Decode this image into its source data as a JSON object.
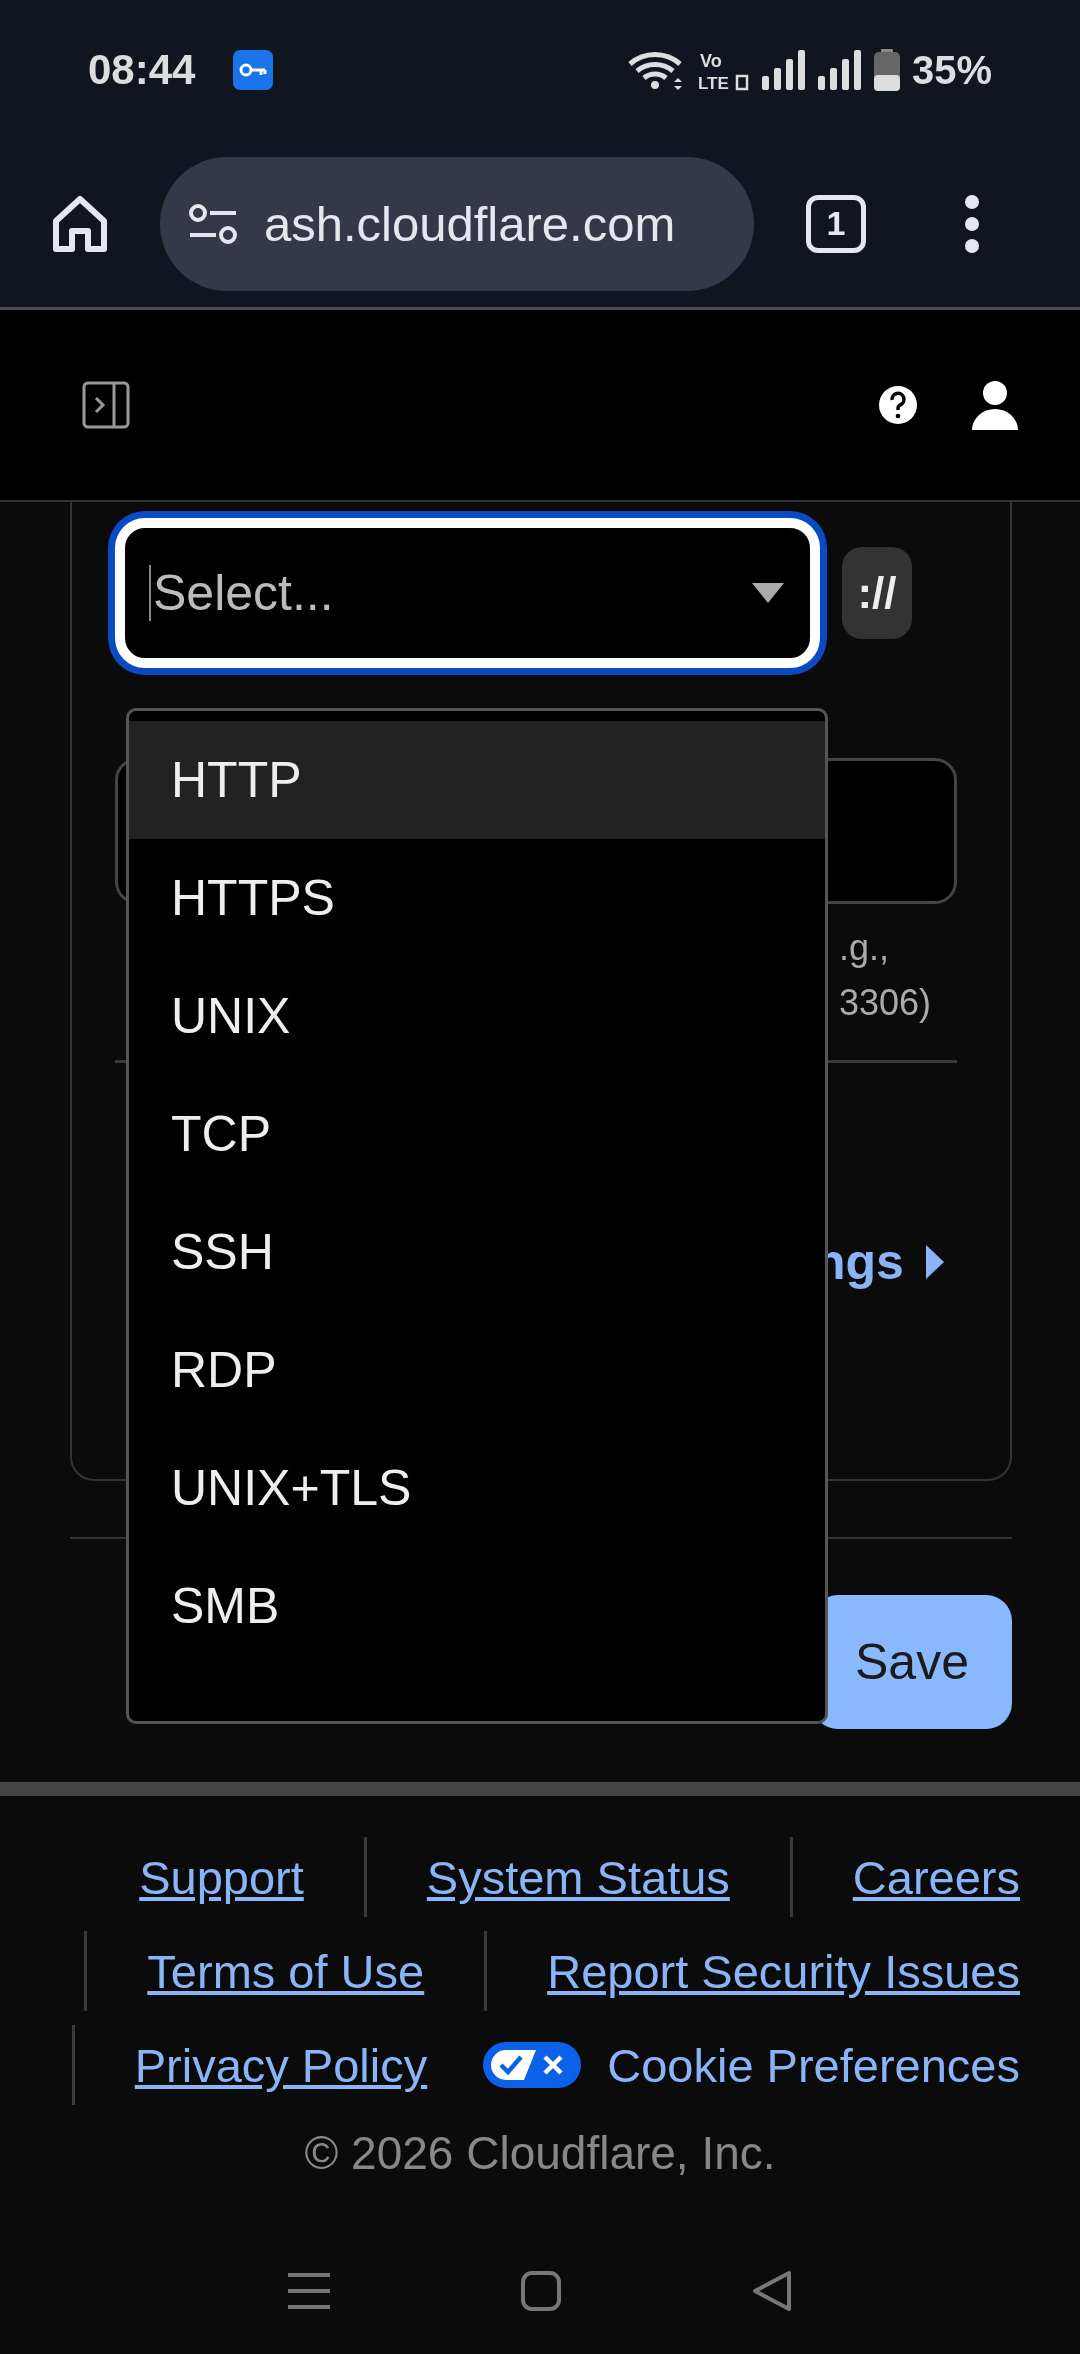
{
  "status_bar": {
    "time": "08:44",
    "battery": "35%",
    "network_top": "Vo",
    "network_bottom": "LTE"
  },
  "browser": {
    "url": "ash.cloudflare.com",
    "tab_count": "1"
  },
  "form": {
    "select_placeholder": "Select...",
    "protocol_button": "://",
    "hint_fragments": [
      ".g.,",
      "3306)"
    ],
    "advanced_link": "ngs",
    "save_button": "Save"
  },
  "dropdown": {
    "options": [
      {
        "label": "HTTP",
        "highlighted": true
      },
      {
        "label": "HTTPS",
        "highlighted": false
      },
      {
        "label": "UNIX",
        "highlighted": false
      },
      {
        "label": "TCP",
        "highlighted": false
      },
      {
        "label": "SSH",
        "highlighted": false
      },
      {
        "label": "RDP",
        "highlighted": false
      },
      {
        "label": "UNIX+TLS",
        "highlighted": false
      },
      {
        "label": "SMB",
        "highlighted": false
      }
    ]
  },
  "footer": {
    "link_rows": [
      [
        "Support",
        "System Status",
        "Careers"
      ],
      [
        "Terms of Use",
        "Report Security Issues"
      ],
      [
        "Privacy Policy"
      ]
    ],
    "cookie_preferences": "Cookie Preferences",
    "copyright": "© 2026 Cloudflare, Inc."
  }
}
